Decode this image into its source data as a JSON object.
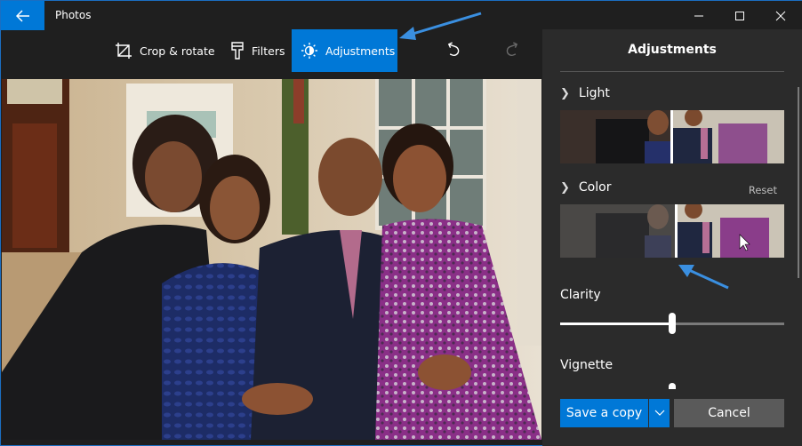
{
  "window": {
    "app_title": "Photos",
    "controls": {
      "minimize": "minimize-icon",
      "maximize": "maximize-icon",
      "close": "close-icon"
    },
    "accent_color": "#0078d7"
  },
  "toolbar": {
    "crop_label": "Crop & rotate",
    "filters_label": "Filters",
    "adjustments_label": "Adjustments",
    "active_tool": "Adjustments",
    "undo_icon": "undo-icon",
    "redo_icon": "redo-icon"
  },
  "panel": {
    "title": "Adjustments",
    "sections": [
      {
        "label": "Light",
        "expanded": false,
        "thumbnail_split": 0.5
      },
      {
        "label": "Color",
        "expanded": false,
        "reset_label": "Reset",
        "thumbnail_split": 0.52
      }
    ],
    "sliders": [
      {
        "label": "Clarity",
        "value": 0.5
      },
      {
        "label": "Vignette",
        "value": 0.5
      }
    ]
  },
  "footer": {
    "save_label": "Save a copy",
    "cancel_label": "Cancel"
  },
  "photo": {
    "description": "Family portrait of four people seated on a sofa in a room with a window and a grandfather clock"
  },
  "annotations": [
    {
      "type": "arrow",
      "points_to": "adjustments-tab",
      "color": "#3a8fe0"
    },
    {
      "type": "arrow",
      "points_to": "color-thumbnail-split",
      "color": "#3a8fe0"
    }
  ]
}
